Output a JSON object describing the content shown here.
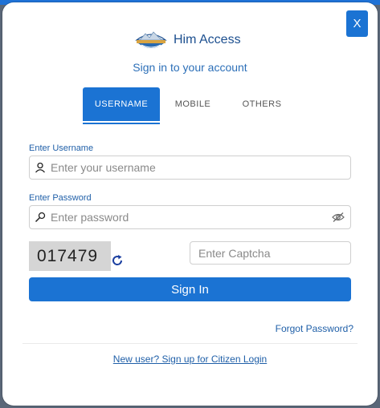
{
  "modal": {
    "close_label": "X",
    "brand_name": "Him Access",
    "subtitle": "Sign in to your account"
  },
  "tabs": [
    {
      "label": "USERNAME",
      "active": true
    },
    {
      "label": "MOBILE",
      "active": false
    },
    {
      "label": "OTHERS",
      "active": false
    }
  ],
  "form": {
    "username_label": "Enter Username",
    "username_placeholder": "Enter your username",
    "username_value": "",
    "password_label": "Enter Password",
    "password_placeholder": "Enter password",
    "password_value": "",
    "captcha_code": "017479",
    "captcha_placeholder": "Enter Captcha",
    "captcha_value": "",
    "submit_label": "Sign In"
  },
  "links": {
    "forgot_password": "Forgot Password?",
    "signup": "New user? Sign up for Citizen Login"
  },
  "icons": {
    "user": "user-icon",
    "password": "key-icon",
    "visibility": "eye-off-icon",
    "refresh": "refresh-icon",
    "logo": "himachal-logo"
  },
  "colors": {
    "primary": "#1b73d3",
    "link": "#1f5fa8",
    "brand_text": "#1c4f8f",
    "backdrop": "#5a6778"
  }
}
